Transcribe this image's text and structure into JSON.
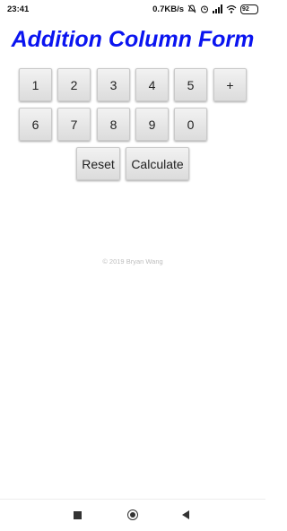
{
  "status_bar": {
    "time": "23:41",
    "network_speed": "0.7KB/s",
    "icons": [
      "mute-icon",
      "alarm-icon",
      "signal-icon",
      "wifi-icon"
    ],
    "battery": "92"
  },
  "app": {
    "title": "Addition Column Form",
    "title_color": "#0a14f0"
  },
  "keypad": {
    "row1": [
      "1",
      "2",
      "3",
      "4",
      "5",
      "+"
    ],
    "row2": [
      "6",
      "7",
      "8",
      "9",
      "0"
    ]
  },
  "actions": {
    "reset_label": "Reset",
    "calculate_label": "Calculate"
  },
  "footer": {
    "copyright": "© 2019 Bryan Wang"
  },
  "nav_bar": {
    "buttons": [
      "recents-icon",
      "home-icon",
      "back-icon"
    ]
  }
}
